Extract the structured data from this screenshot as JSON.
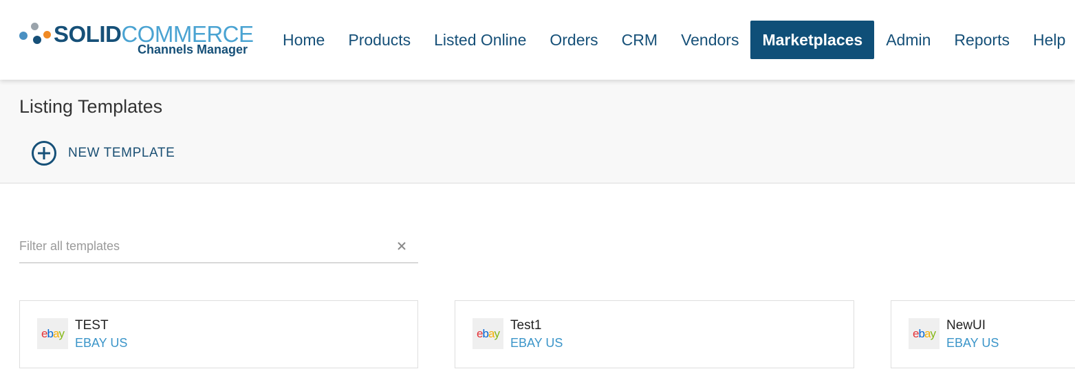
{
  "logo": {
    "brand_bold": "SOLID",
    "brand_light": "COMMERCE",
    "subtitle": "Channels Manager"
  },
  "nav": {
    "items": [
      {
        "label": "Home"
      },
      {
        "label": "Products"
      },
      {
        "label": "Listed Online"
      },
      {
        "label": "Orders"
      },
      {
        "label": "CRM"
      },
      {
        "label": "Vendors"
      },
      {
        "label": "Marketplaces",
        "active": true
      },
      {
        "label": "Admin"
      },
      {
        "label": "Reports"
      },
      {
        "label": "Help"
      }
    ]
  },
  "page": {
    "title": "Listing Templates",
    "new_template_label": "NEW TEMPLATE"
  },
  "filter": {
    "placeholder": "Filter all templates",
    "value": ""
  },
  "templates": [
    {
      "name": "TEST",
      "marketplace": "EBAY US",
      "icon": "ebay-logo"
    },
    {
      "name": "Test1",
      "marketplace": "EBAY US",
      "icon": "ebay-logo"
    },
    {
      "name": "NewUI",
      "marketplace": "EBAY US",
      "icon": "ebay-logo"
    }
  ],
  "colors": {
    "primary": "#165078",
    "active_nav_bg": "#0f4f78",
    "accent_light": "#4aa3d2",
    "marketplace_text": "#3b95c9",
    "subheader_bg": "#f8f8f8"
  },
  "ebay_logo_letters": [
    "e",
    "b",
    "a",
    "y"
  ]
}
